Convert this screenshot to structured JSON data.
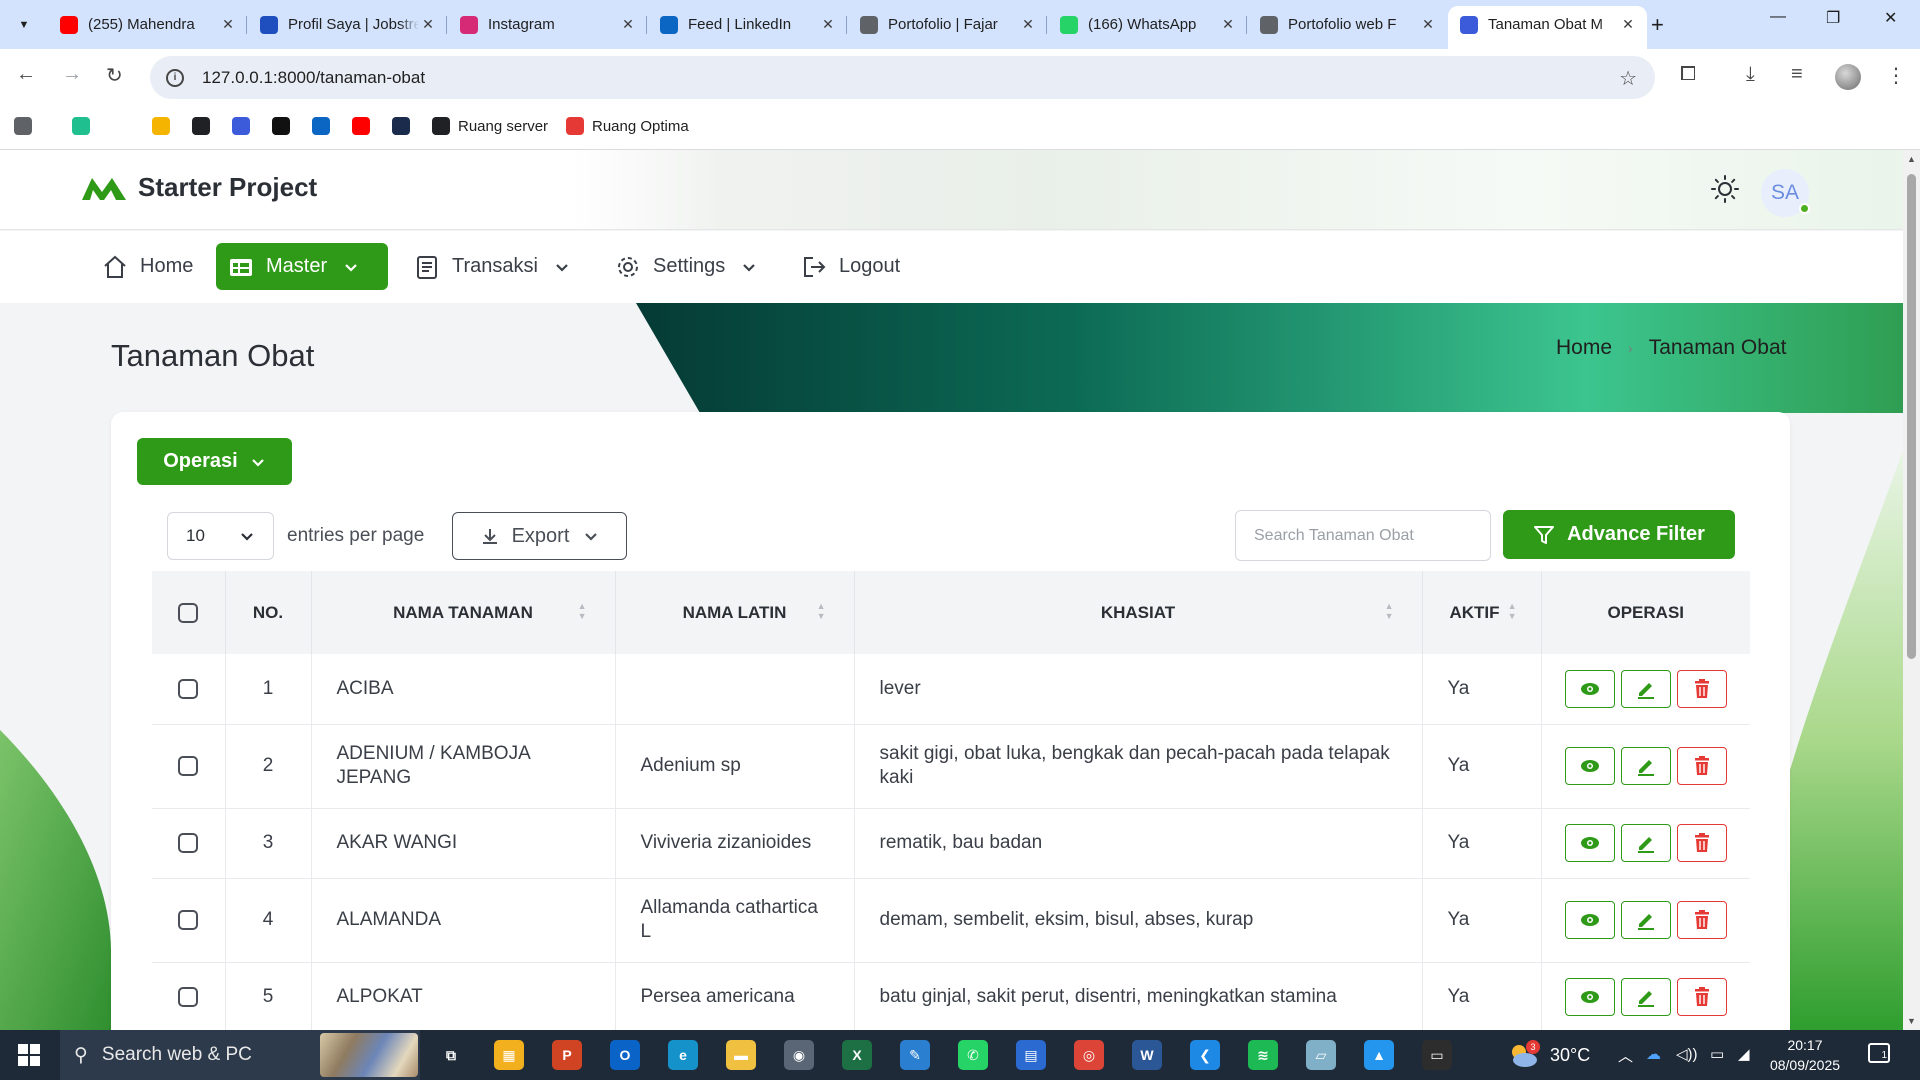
{
  "browser": {
    "tabs": [
      {
        "title": "(255) Mahendra",
        "favicon": "youtube-icon",
        "color": "#ff0000"
      },
      {
        "title": "Profil Saya | Jobstreet",
        "favicon": "globe-icon",
        "color": "#1f4fbf"
      },
      {
        "title": "Instagram",
        "favicon": "instagram-icon",
        "color": "#d62976"
      },
      {
        "title": "Feed | LinkedIn",
        "favicon": "linkedin-icon",
        "color": "#0a66c2"
      },
      {
        "title": "Portofolio | Fajar",
        "favicon": "globe-icon",
        "color": "#5f6368"
      },
      {
        "title": "(166) WhatsApp",
        "favicon": "whatsapp-icon",
        "color": "#25d366"
      },
      {
        "title": "Portofolio web F",
        "favicon": "openai-icon",
        "color": "#5f6368"
      },
      {
        "title": "Tanaman Obat M",
        "favicon": "brand-m-icon",
        "color": "#3b5bdb",
        "active": true
      }
    ],
    "url": "127.0.0.1:8000/tanaman-obat",
    "bookmarks": [
      {
        "label": "",
        "icon": "apps-grid-icon",
        "color": "#5f6368"
      },
      {
        "label": "",
        "icon": "flag-icon",
        "color": "#1fbf8f"
      },
      {
        "label": "",
        "icon": "google-drive-icon",
        "color": "#f4b400"
      },
      {
        "label": "",
        "icon": "chatgpt-icon",
        "color": "#202124"
      },
      {
        "label": "",
        "icon": "codeium-icon",
        "color": "#3b5bdb"
      },
      {
        "label": "",
        "icon": "circle-app-icon",
        "color": "#111111"
      },
      {
        "label": "",
        "icon": "linkedin-icon",
        "color": "#0a66c2"
      },
      {
        "label": "",
        "icon": "youtube-icon",
        "color": "#ff0000"
      },
      {
        "label": "",
        "icon": "cube-icon",
        "color": "#1a2b4c"
      },
      {
        "label": "Ruang server",
        "icon": "arrow-up-icon",
        "color": "#202124"
      },
      {
        "label": "Ruang Optima",
        "icon": "optima-icon",
        "color": "#e53935"
      }
    ]
  },
  "app": {
    "brand": "Starter Project",
    "user_initials": "SA",
    "accent": "#2e9a17",
    "menu": [
      {
        "label": "Home",
        "icon": "home-icon",
        "dropdown": false
      },
      {
        "label": "Master",
        "icon": "grid-table-icon",
        "dropdown": true,
        "active": true
      },
      {
        "label": "Transaksi",
        "icon": "document-list-icon",
        "dropdown": true
      },
      {
        "label": "Settings",
        "icon": "gear-icon",
        "dropdown": true
      },
      {
        "label": "Logout",
        "icon": "logout-icon",
        "dropdown": false
      }
    ],
    "page_title": "Tanaman Obat",
    "breadcrumb": [
      "Home",
      "Tanaman Obat"
    ],
    "toolbar": {
      "operasi_label": "Operasi",
      "per_page_value": "10",
      "per_page_label": "entries per page",
      "export_label": "Export",
      "search_placeholder": "Search Tanaman Obat",
      "filter_label": "Advance Filter"
    },
    "table": {
      "columns": [
        "No.",
        "Nama Tanaman",
        "Nama Latin",
        "Khasiat",
        "Aktif",
        "Operasi"
      ],
      "rows": [
        {
          "no": "1",
          "nama": "ACIBA",
          "latin": "",
          "khasiat": "lever",
          "aktif": "Ya"
        },
        {
          "no": "2",
          "nama": "ADENIUM / KAMBOJA JEPANG",
          "latin": "Adenium sp",
          "khasiat": "sakit gigi, obat luka, bengkak dan pecah-pacah pada telapak kaki",
          "aktif": "Ya"
        },
        {
          "no": "3",
          "nama": "AKAR WANGI",
          "latin": "Viviveria zizanioides",
          "khasiat": "rematik, bau badan",
          "aktif": "Ya"
        },
        {
          "no": "4",
          "nama": "ALAMANDA",
          "latin": "Allamanda cathartica L",
          "khasiat": "demam, sembelit, eksim, bisul, abses, kurap",
          "aktif": "Ya"
        },
        {
          "no": "5",
          "nama": "ALPOKAT",
          "latin": "Persea americana",
          "khasiat": "batu ginjal, sakit perut, disentri, meningkatkan stamina",
          "aktif": "Ya"
        }
      ]
    }
  },
  "taskbar": {
    "search_label": "Search web & PC",
    "temperature": "30°C",
    "weather_badge": "3",
    "time": "20:17",
    "date": "08/09/2025",
    "notification_count": "1",
    "apps": [
      {
        "icon": "task-view-icon",
        "color": "#1f2a38",
        "glyph": "⧉"
      },
      {
        "icon": "store-icon",
        "color": "#f2b01e",
        "glyph": "▦"
      },
      {
        "icon": "powerpoint-icon",
        "color": "#d04423",
        "glyph": "P"
      },
      {
        "icon": "outlook-icon",
        "color": "#0a64c8",
        "glyph": "O"
      },
      {
        "icon": "edge-icon",
        "color": "#1592c9",
        "glyph": "e"
      },
      {
        "icon": "file-explorer-icon",
        "color": "#f0c040",
        "glyph": "▬"
      },
      {
        "icon": "camera-icon",
        "color": "#5a6675",
        "glyph": "◉"
      },
      {
        "icon": "excel-icon",
        "color": "#1d7044",
        "glyph": "X"
      },
      {
        "icon": "paint-icon",
        "color": "#2a7fd1",
        "glyph": "✎"
      },
      {
        "icon": "whatsapp-icon",
        "color": "#25d366",
        "glyph": "✆"
      },
      {
        "icon": "calendar-icon",
        "color": "#2a6ad1",
        "glyph": "▤"
      },
      {
        "icon": "chrome-icon",
        "color": "#db4437",
        "glyph": "◎",
        "active": true
      },
      {
        "icon": "word-icon",
        "color": "#2b5797",
        "glyph": "W"
      },
      {
        "icon": "vscode-icon",
        "color": "#1e88e5",
        "glyph": "❮"
      },
      {
        "icon": "spotify-icon",
        "color": "#1db954",
        "glyph": "≋"
      },
      {
        "icon": "notes-icon",
        "color": "#7fb0c8",
        "glyph": "▱"
      },
      {
        "icon": "docker-icon",
        "color": "#2496ed",
        "glyph": "▲"
      },
      {
        "icon": "terminal-icon",
        "color": "#2d2d2d",
        "glyph": "▭"
      }
    ]
  }
}
